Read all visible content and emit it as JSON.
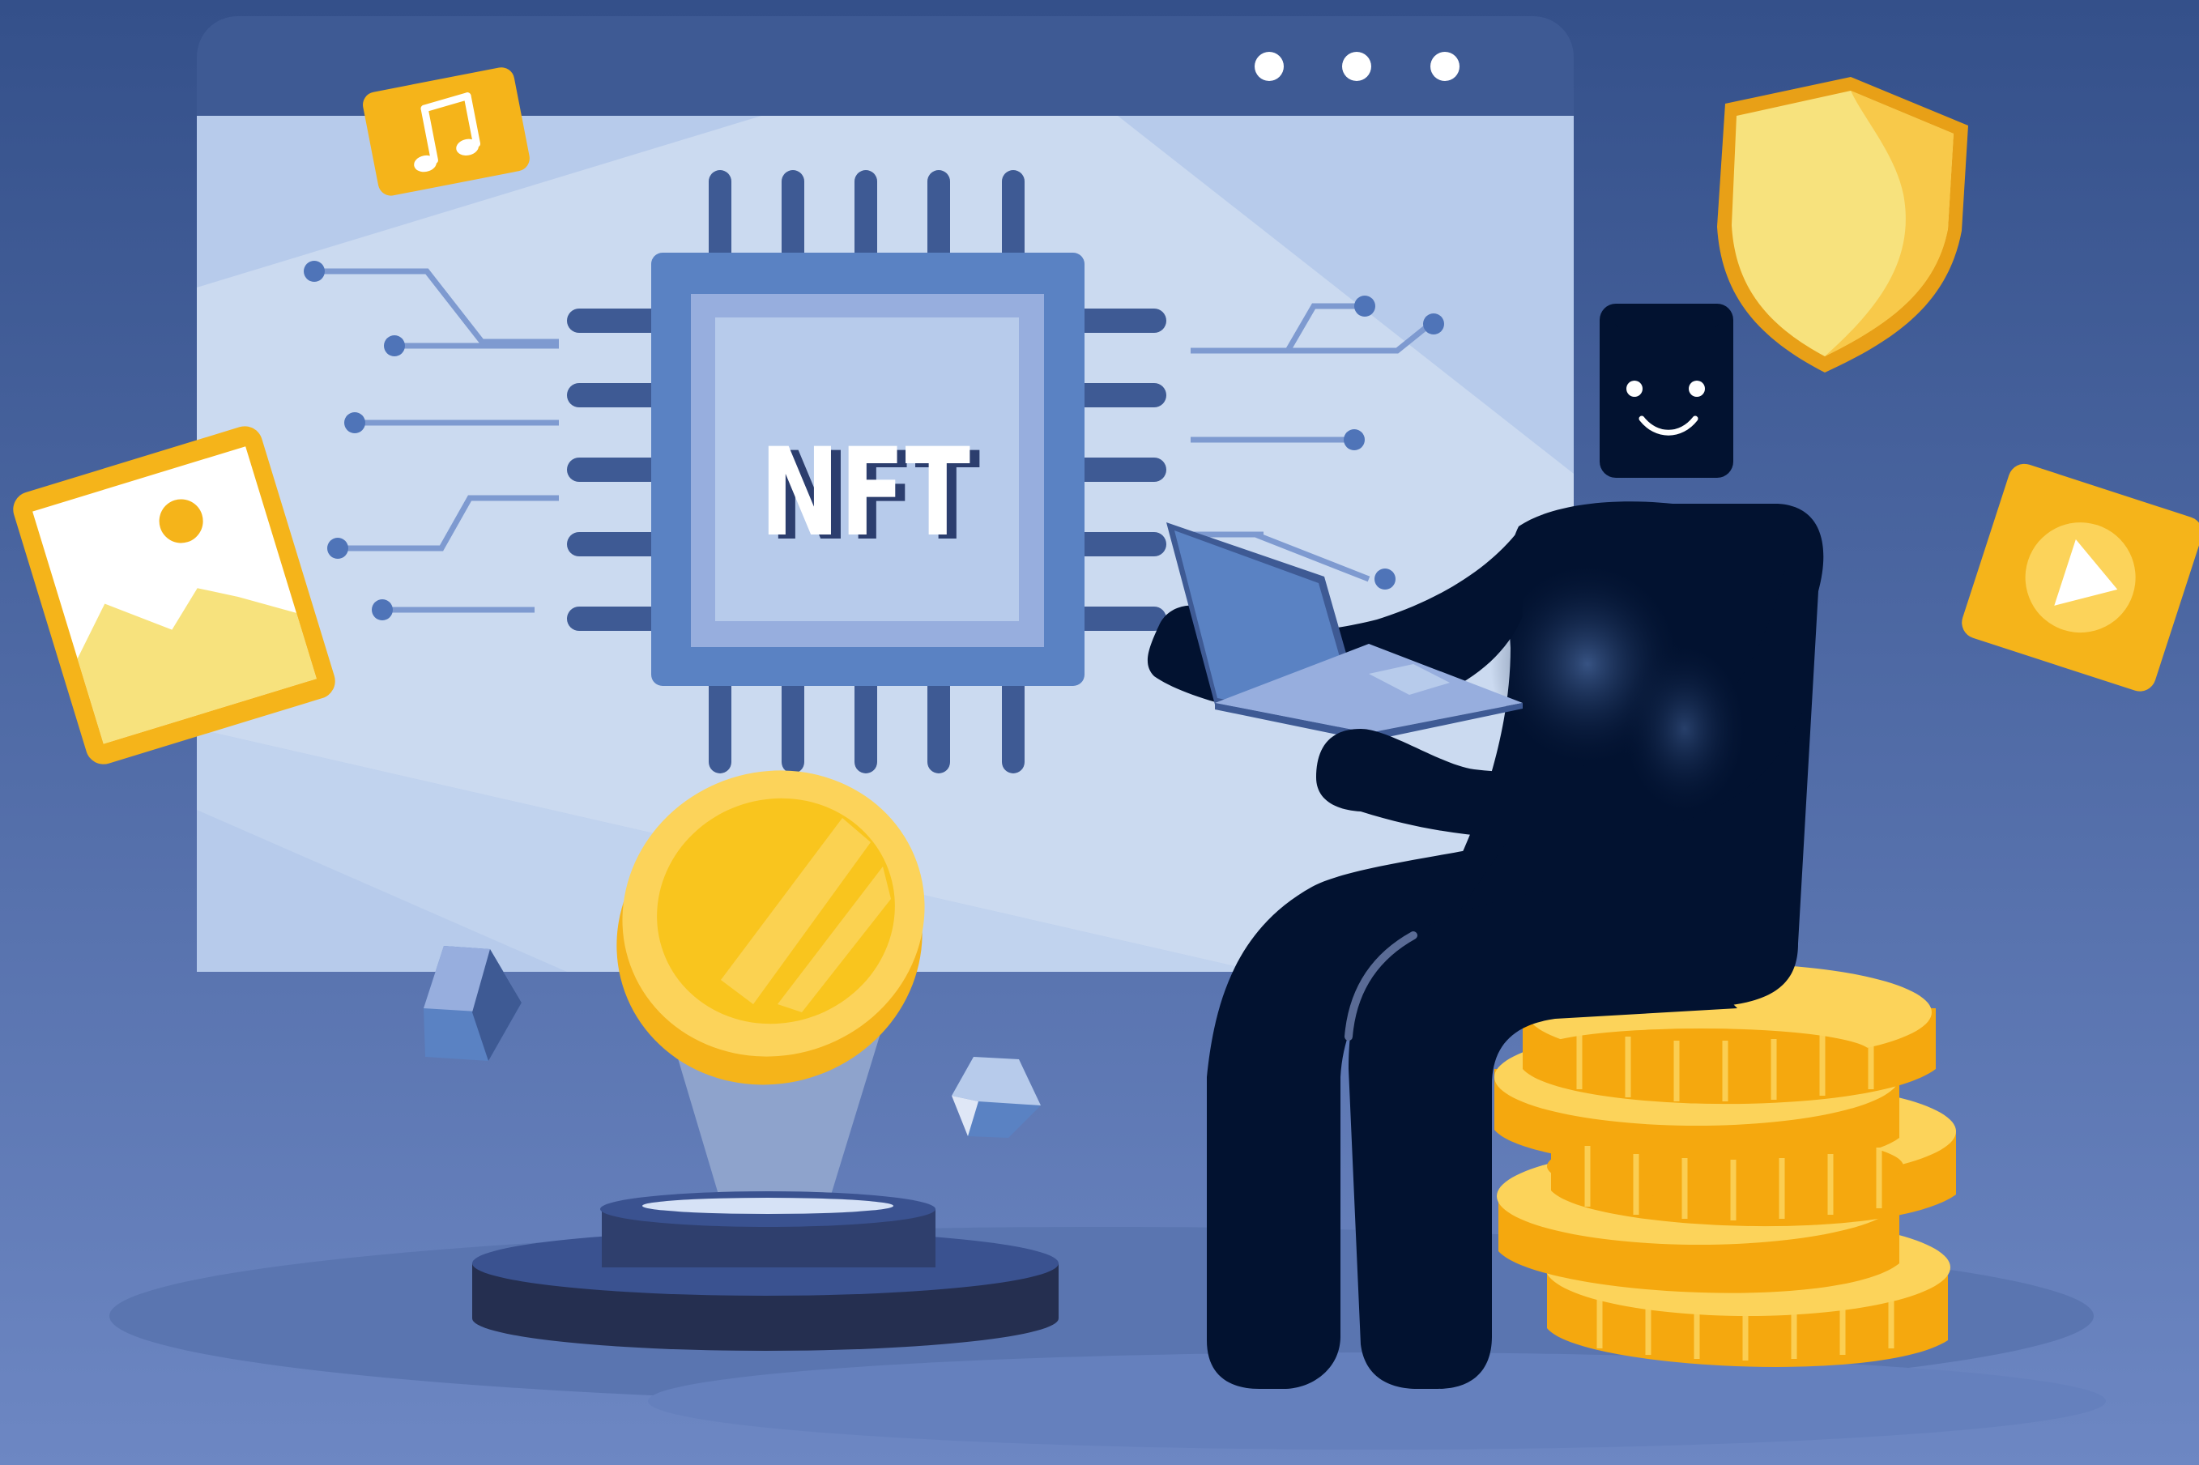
{
  "scene": {
    "chip_label": "NFT",
    "window_dots": 3,
    "icons": [
      "music-note-icon",
      "image-icon",
      "play-icon",
      "shield-icon"
    ],
    "colors": {
      "background_top": "#34508a",
      "background_bottom": "#6d87c3",
      "browser_frame": "#3e5a94",
      "browser_screen": "#b7cbeb",
      "chip": "#5a82c3",
      "gold": "#f5b41a",
      "gold_light": "#fcd35a",
      "figure": "#021230"
    }
  }
}
